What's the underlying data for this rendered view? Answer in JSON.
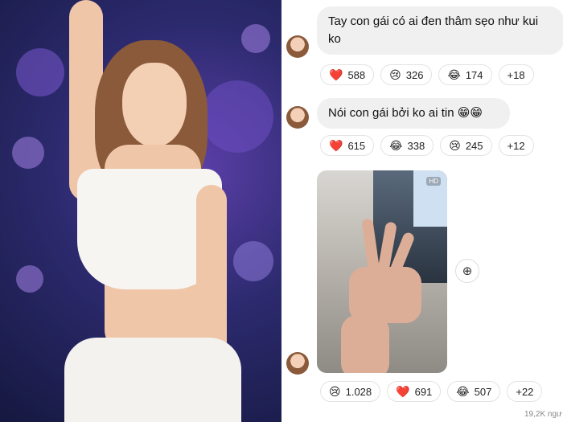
{
  "messages": [
    {
      "text": "Tay con gái có ai đen thâm sẹo như kui ko",
      "reactions": [
        {
          "emoji": "❤️",
          "icon": "heart-icon",
          "count": "588"
        },
        {
          "emoji": "😢",
          "icon": "cry-face-icon",
          "count": "326"
        },
        {
          "emoji": "😂",
          "icon": "laugh-face-icon",
          "count": "174"
        }
      ],
      "more": "+18"
    },
    {
      "text": "Nói con gái bởi ko ai tin 😁😁",
      "reactions": [
        {
          "emoji": "❤️",
          "icon": "heart-icon",
          "count": "615"
        },
        {
          "emoji": "😂",
          "icon": "laugh-face-icon",
          "count": "338"
        },
        {
          "emoji": "😢",
          "icon": "cry-face-icon",
          "count": "245"
        }
      ],
      "more": "+12"
    },
    {
      "media_badge": "HD",
      "reactions": [
        {
          "emoji": "😢",
          "icon": "cry-face-icon",
          "count": "1.028"
        },
        {
          "emoji": "❤️",
          "icon": "heart-icon",
          "count": "691"
        },
        {
          "emoji": "😂",
          "icon": "laugh-face-icon",
          "count": "507"
        }
      ],
      "more": "+22"
    }
  ],
  "add_reaction_icon": "add-reaction-icon",
  "views": "19,2K ngư"
}
